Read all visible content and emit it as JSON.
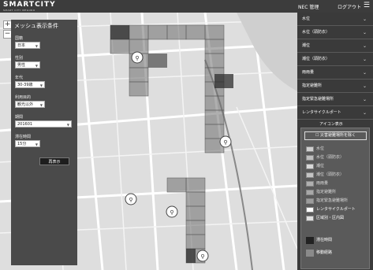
{
  "header": {
    "logo": "SMARTCITY",
    "logo_sub": "SMART CITY MEGURO",
    "nec_admin": "NEC 管理",
    "logout": "ログアウト",
    "menu_icon": "hamburger-icon"
  },
  "panel": {
    "title": "メッシュ表示条件",
    "fields": [
      {
        "label": "国籍",
        "value": "日本"
      },
      {
        "label": "性別",
        "value": "男性"
      },
      {
        "label": "年代",
        "value": "30-39歳"
      },
      {
        "label": "利用目的",
        "value": "観光以外"
      },
      {
        "label": "期間",
        "value": "201601"
      },
      {
        "label": "滞在時間",
        "value": "15分"
      }
    ],
    "redisplay": "再表示"
  },
  "sidebar": {
    "layers": [
      "水位",
      "水位（頭防衣）",
      "潮位",
      "潮位（頭防衣）",
      "雨雨量",
      "指定避難所",
      "指定緊急避難場所",
      "レンタサイクルポート"
    ],
    "icon_display_title": "アイコン表示",
    "icon_button": "災害避難場所を除く",
    "legend": [
      {
        "label": "水位",
        "color": "#cfcfcf"
      },
      {
        "label": "水位（頭防衣）",
        "color": "#bdbdbd"
      },
      {
        "label": "潮位",
        "color": "#d8d8d8"
      },
      {
        "label": "潮位（頭防衣）",
        "color": "#c4c4c4"
      },
      {
        "label": "雨雨量",
        "color": "#b0b0b0"
      },
      {
        "label": "指定避難所",
        "color": "#a8a8a8"
      },
      {
        "label": "指定緊急避難場所",
        "color": "#9c9c9c"
      },
      {
        "label": "レンタサイクルポート",
        "color": "#ffffff"
      },
      {
        "label": "区域別・区内図",
        "color": "#e0e0e0"
      }
    ],
    "legend_big": [
      {
        "label": "滞在時間",
        "color": "#222222"
      },
      {
        "label": "移動経路",
        "color": "#8a8a8a"
      }
    ]
  },
  "map": {
    "zoom_in": "+",
    "zoom_out": "−"
  }
}
